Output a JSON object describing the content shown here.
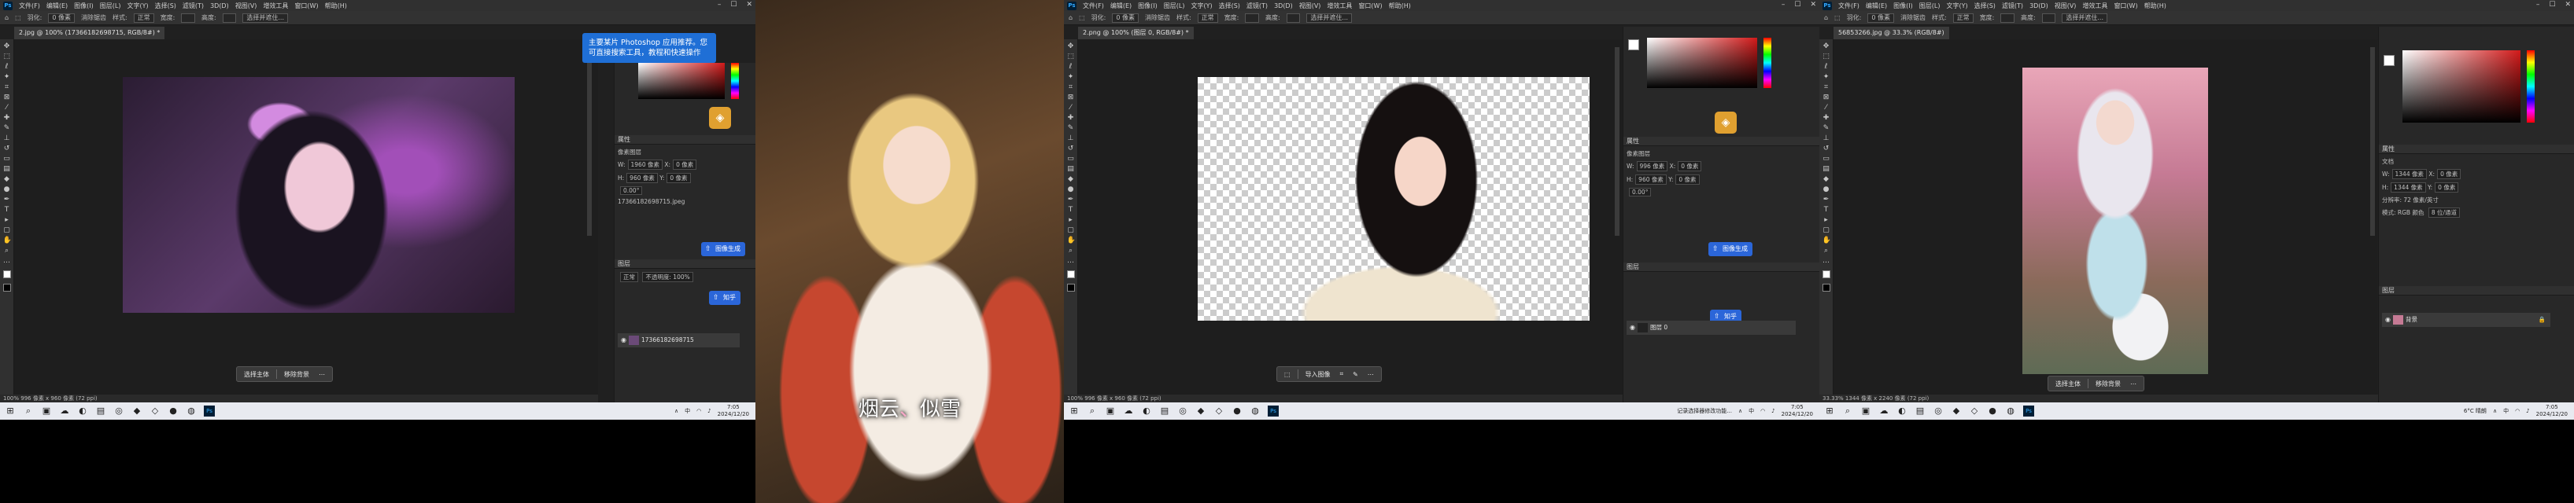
{
  "pane1": {
    "menu": [
      "文件(F)",
      "编辑(E)",
      "图像(I)",
      "图层(L)",
      "文字(Y)",
      "选择(S)",
      "滤镜(T)",
      "3D(D)",
      "视图(V)",
      "增效工具",
      "窗口(W)",
      "帮助(H)"
    ],
    "options": [
      "羽化:",
      "0 像素",
      "消除锯齿",
      "样式:",
      "正常",
      "宽度:",
      "高度:",
      "选择并遮住..."
    ],
    "doc_tab": "2.jpg @ 100% (17366182698715, RGB/8#) *",
    "tooltip": "主要某片 Photoshop 应用推荐。您可直接搜索工具，教程和快速操作",
    "properties_title": "属性",
    "adjust_title": "像素图层",
    "props": [
      {
        "label": "W:",
        "value": "1960 像素",
        "label2": "X:",
        "value2": "0 像素"
      },
      {
        "label": "H:",
        "value": "960 像素",
        "label2": "Y:",
        "value2": "0 像素"
      }
    ],
    "angle": "0.00°",
    "filename": "17366182698715.jpeg",
    "ai_button": "图像生成",
    "ai_button2": "知乎",
    "layers_title": "图层",
    "layer_name": "17366182698715",
    "mode": "正常",
    "opacity": "不透明度: 100%",
    "ctx_left": "选择主体",
    "ctx_right": "移除背景",
    "status": "100%     996 像素 x 960 像素 (72 ppi)"
  },
  "pane2": {
    "subtitle_a": "烟云",
    "subtitle_dot": "、",
    "subtitle_b": "似雪"
  },
  "pane3": {
    "menu": [
      "文件(F)",
      "编辑(E)",
      "图像(I)",
      "图层(L)",
      "文字(Y)",
      "选择(S)",
      "滤镜(T)",
      "3D(D)",
      "视图(V)",
      "增效工具",
      "窗口(W)",
      "帮助(H)"
    ],
    "options": [
      "羽化:",
      "0 像素",
      "消除锯齿",
      "样式:",
      "正常",
      "宽度:",
      "高度:",
      "选择并遮住..."
    ],
    "doc_tab": "2.png @ 100% (图层 0, RGB/8#) *",
    "properties_title": "属性",
    "adjust_title": "像素图层",
    "props": [
      {
        "label": "W:",
        "value": "996 像素",
        "label2": "X:",
        "value2": "0 像素"
      },
      {
        "label": "H:",
        "value": "960 像素",
        "label2": "Y:",
        "value2": "0 像素"
      }
    ],
    "angle": "0.00°",
    "ai_button": "图像生成",
    "ai_button2": "知乎",
    "layers_title": "图层",
    "layer_name": "图层 0",
    "ctx_left": "导入图像",
    "status": "100%     996 像素 x 960 像素 (72 ppi)",
    "taskbar_note": "记录选择器修改功能..."
  },
  "pane4": {
    "menu": [
      "文件(F)",
      "编辑(E)",
      "图像(I)",
      "图层(L)",
      "文字(Y)",
      "选择(S)",
      "滤镜(T)",
      "3D(D)",
      "视图(V)",
      "增效工具",
      "窗口(W)",
      "帮助(H)"
    ],
    "options": [
      "羽化:",
      "0 像素",
      "消除锯齿",
      "样式:",
      "正常",
      "宽度:",
      "高度:",
      "选择并遮住..."
    ],
    "doc_tab": "56853266.jpg @ 33.3% (RGB/8#)",
    "properties_title": "属性",
    "adjust_title": "文档",
    "props": [
      {
        "label": "W:",
        "value": "1344 像素",
        "label2": "X:",
        "value2": "0 像素"
      },
      {
        "label": "H:",
        "value": "1344 像素",
        "label2": "Y:",
        "value2": "0 像素"
      }
    ],
    "resolution": "分辨率: 72 像素/英寸",
    "mode_label": "模式: RGB 颜色",
    "depth": "8 位/通道",
    "layers_title": "图层",
    "layer_name": "背景",
    "ctx_left": "选择主体",
    "ctx_right": "移除背景",
    "status": "33.33%     1344 像素 x 2240 像素 (72 ppi)",
    "weather": "6°C 晴朗"
  },
  "taskbar": {
    "time": "7:05",
    "date": "2024/12/20",
    "lang": "中"
  },
  "colors": {
    "ps_bg": "#202020",
    "ps_panel": "#282828",
    "accent_blue": "#2b66d9",
    "tooltip_blue": "#1f6fd6"
  }
}
